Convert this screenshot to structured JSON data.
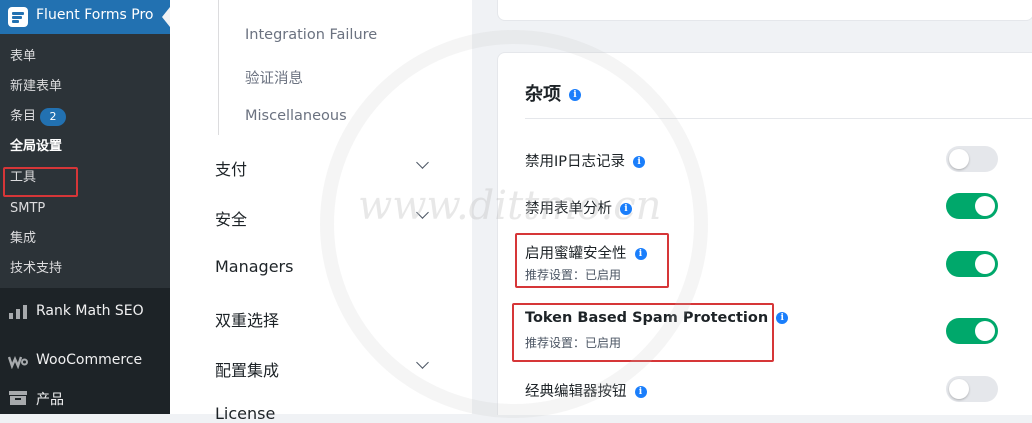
{
  "sidebar": {
    "plugin_title": "Fluent Forms Pro",
    "submenu": [
      {
        "label": "表单"
      },
      {
        "label": "新建表单"
      },
      {
        "label": "条目",
        "badge": "2"
      },
      {
        "label": "全局设置",
        "active": true
      },
      {
        "label": "工具"
      },
      {
        "label": "SMTP"
      },
      {
        "label": "集成"
      },
      {
        "label": "技术支持"
      }
    ],
    "main_menu": [
      {
        "label": "Rank Math SEO",
        "icon": "chart-icon"
      },
      {
        "label": "WooCommerce",
        "icon": "woo-icon"
      },
      {
        "label": "产品",
        "icon": "archive-icon"
      }
    ]
  },
  "settings_nav": {
    "sub_items": [
      "Integration Failure",
      "验证消息",
      "Miscellaneous"
    ],
    "sections": [
      {
        "label": "支付",
        "expandable": true
      },
      {
        "label": "安全",
        "expandable": true
      },
      {
        "label": "Managers",
        "expandable": false
      },
      {
        "label": "双重选择",
        "expandable": false
      },
      {
        "label": "配置集成",
        "expandable": true
      },
      {
        "label": "License",
        "expandable": false
      }
    ]
  },
  "misc_card": {
    "title": "杂项",
    "rows": [
      {
        "label": "禁用IP日志记录",
        "sub": "",
        "enabled": false
      },
      {
        "label": "禁用表单分析",
        "sub": "",
        "enabled": true
      },
      {
        "label": "启用蜜罐安全性",
        "sub": "推荐设置：已启用",
        "enabled": true
      },
      {
        "label": "Token Based Spam Protection",
        "sub": "推荐设置：已启用",
        "enabled": true
      },
      {
        "label": "经典编辑器按钮",
        "sub": "",
        "enabled": false
      }
    ]
  },
  "watermark": "www.dittmo.cn",
  "colors": {
    "accent": "#2271b1",
    "toggle_on": "#00a86b",
    "highlight": "#d63638",
    "info": "#1a7efb"
  }
}
